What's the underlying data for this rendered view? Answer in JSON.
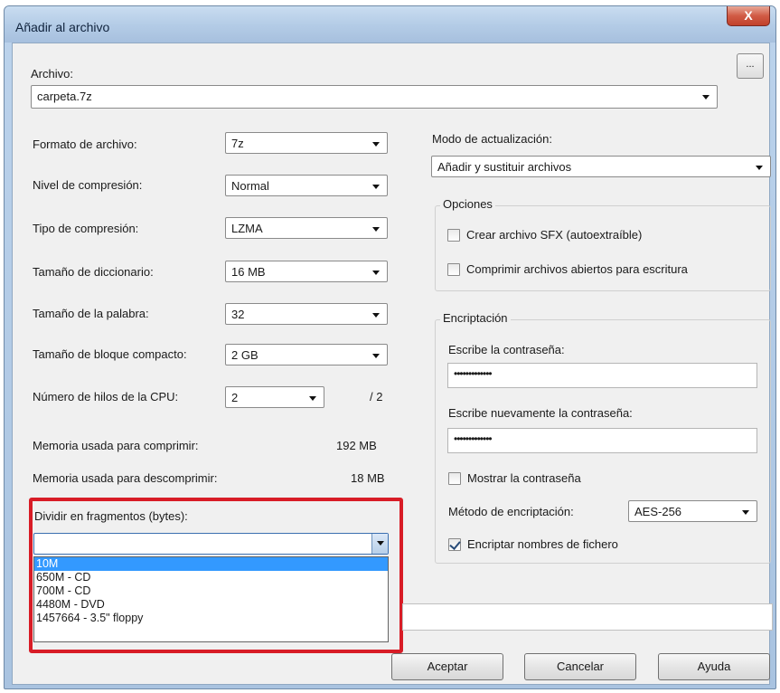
{
  "window": {
    "title": "Añadir al archivo",
    "close": "X"
  },
  "archive": {
    "label": "Archivo:",
    "value": "carpeta.7z",
    "browse": "..."
  },
  "left": {
    "format": {
      "label": "Formato de archivo:",
      "value": "7z"
    },
    "level": {
      "label": "Nivel de compresión:",
      "value": "Normal"
    },
    "type": {
      "label": "Tipo de compresión:",
      "value": "LZMA"
    },
    "dict": {
      "label": "Tamaño de diccionario:",
      "value": "16 MB"
    },
    "word": {
      "label": "Tamaño de la palabra:",
      "value": "32"
    },
    "block": {
      "label": "Tamaño de bloque compacto:",
      "value": "2 GB"
    },
    "threads": {
      "label": "Número de hilos de la CPU:",
      "value": "2",
      "max": "/ 2"
    },
    "mem_compress": {
      "label": "Memoria usada para comprimir:",
      "value": "192 MB"
    },
    "mem_decompress": {
      "label": "Memoria usada para descomprimir:",
      "value": "18 MB"
    }
  },
  "split": {
    "label": "Dividir en fragmentos (bytes):",
    "value": "",
    "options": [
      "10M",
      "650M - CD",
      "700M - CD",
      "4480M - DVD",
      "1457664 - 3.5\" floppy"
    ],
    "selected_index": 0
  },
  "update": {
    "label": "Modo de actualización:",
    "value": "Añadir y sustituir archivos"
  },
  "options": {
    "title": "Opciones",
    "sfx": {
      "label": "Crear archivo SFX (autoextraíble)",
      "checked": false
    },
    "open_files": {
      "label": "Comprimir archivos abiertos para escritura",
      "checked": false
    }
  },
  "encryption": {
    "title": "Encriptación",
    "password_label": "Escribe la contraseña:",
    "password_value": "•••••••••••••",
    "repeat_label": "Escribe nuevamente la contraseña:",
    "repeat_value": "•••••••••••••",
    "show_label": "Mostrar la contraseña",
    "show_checked": false,
    "method_label": "Método de encriptación:",
    "method_value": "AES-256",
    "names_label": "Encriptar nombres de fichero",
    "names_checked": true
  },
  "buttons": {
    "ok": "Aceptar",
    "cancel": "Cancelar",
    "help": "Ayuda"
  },
  "colors": {
    "highlight": "#d81c26",
    "selection": "#3399ff"
  }
}
